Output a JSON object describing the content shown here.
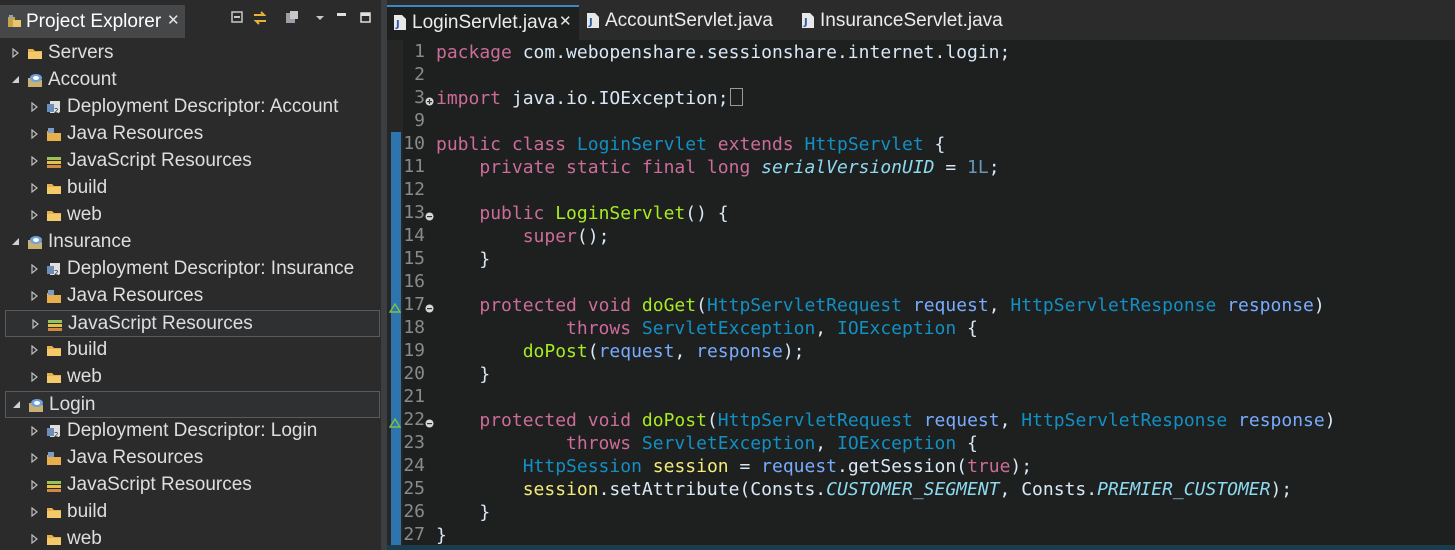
{
  "explorer": {
    "title": "Project Explorer",
    "close_glyph": "✕",
    "toolbar": [
      {
        "icon": "collapse-all-icon"
      },
      {
        "icon": "link-with-editor-icon"
      },
      {
        "icon": "filter-icon"
      },
      {
        "icon": "view-menu-icon"
      },
      {
        "icon": "minimize-icon"
      },
      {
        "icon": "maximize-icon"
      }
    ],
    "tree": [
      {
        "label": "Servers",
        "level": 1,
        "expanded": false,
        "icon": "folder-icon"
      },
      {
        "label": "Account",
        "level": 1,
        "expanded": true,
        "icon": "web-project-icon"
      },
      {
        "label": "Deployment Descriptor: Account",
        "level": 2,
        "expanded": false,
        "icon": "deployment-descriptor-icon"
      },
      {
        "label": "Java Resources",
        "level": 2,
        "expanded": false,
        "icon": "java-resources-icon"
      },
      {
        "label": "JavaScript Resources",
        "level": 2,
        "expanded": false,
        "icon": "javascript-resources-icon"
      },
      {
        "label": "build",
        "level": 2,
        "expanded": false,
        "icon": "folder-icon"
      },
      {
        "label": "web",
        "level": 2,
        "expanded": false,
        "icon": "folder-icon"
      },
      {
        "label": "Insurance",
        "level": 1,
        "expanded": true,
        "icon": "web-project-icon"
      },
      {
        "label": "Deployment Descriptor: Insurance",
        "level": 2,
        "expanded": false,
        "icon": "deployment-descriptor-icon"
      },
      {
        "label": "Java Resources",
        "level": 2,
        "expanded": false,
        "icon": "java-resources-icon"
      },
      {
        "label": "JavaScript Resources",
        "level": 2,
        "expanded": false,
        "icon": "javascript-resources-icon",
        "hover": true
      },
      {
        "label": "build",
        "level": 2,
        "expanded": false,
        "icon": "folder-icon"
      },
      {
        "label": "web",
        "level": 2,
        "expanded": false,
        "icon": "folder-icon"
      },
      {
        "label": "Login",
        "level": 1,
        "expanded": true,
        "icon": "web-project-icon",
        "selected": true
      },
      {
        "label": "Deployment Descriptor: Login",
        "level": 2,
        "expanded": false,
        "icon": "deployment-descriptor-icon"
      },
      {
        "label": "Java Resources",
        "level": 2,
        "expanded": false,
        "icon": "java-resources-icon"
      },
      {
        "label": "JavaScript Resources",
        "level": 2,
        "expanded": false,
        "icon": "javascript-resources-icon"
      },
      {
        "label": "build",
        "level": 2,
        "expanded": false,
        "icon": "folder-icon"
      },
      {
        "label": "web",
        "level": 2,
        "expanded": false,
        "icon": "folder-icon"
      }
    ]
  },
  "editor": {
    "tabs": [
      {
        "label": "LoginServlet.java",
        "active": true,
        "close": "✕"
      },
      {
        "label": "AccountServlet.java",
        "active": false
      },
      {
        "label": "InsuranceServlet.java",
        "active": false
      }
    ],
    "lines": [
      {
        "n": "1",
        "tokens": [
          [
            "kw",
            "package"
          ],
          [
            "plain",
            " com.webopenshare.sessionshare.internet.login;"
          ]
        ]
      },
      {
        "n": "2",
        "tokens": []
      },
      {
        "n": "3",
        "fold": "expand",
        "tokens": [
          [
            "kw",
            "import"
          ],
          [
            "plain",
            " java.io.IOException;"
          ],
          [
            "box",
            ""
          ]
        ]
      },
      {
        "n": "9",
        "tokens": []
      },
      {
        "n": "10",
        "tokens": [
          [
            "kw",
            "public class "
          ],
          [
            "cls",
            "LoginServlet"
          ],
          [
            "kw",
            " extends "
          ],
          [
            "cls",
            "HttpServlet"
          ],
          [
            "plain",
            " {"
          ]
        ]
      },
      {
        "n": "11",
        "tokens": [
          [
            "plain",
            "    "
          ],
          [
            "kw",
            "private static final long "
          ],
          [
            "field",
            "serialVersionUID"
          ],
          [
            "plain",
            " = "
          ],
          [
            "num",
            "1L"
          ],
          [
            "plain",
            ";"
          ]
        ]
      },
      {
        "n": "12",
        "tokens": []
      },
      {
        "n": "13",
        "fold": "collapse",
        "tokens": [
          [
            "plain",
            "    "
          ],
          [
            "kw",
            "public "
          ],
          [
            "meth",
            "LoginServlet"
          ],
          [
            "plain",
            "() {"
          ]
        ]
      },
      {
        "n": "14",
        "tokens": [
          [
            "plain",
            "        "
          ],
          [
            "kw",
            "super"
          ],
          [
            "plain",
            "();"
          ]
        ]
      },
      {
        "n": "15",
        "tokens": [
          [
            "plain",
            "    }"
          ]
        ]
      },
      {
        "n": "16",
        "tokens": []
      },
      {
        "n": "17",
        "fold": "collapse",
        "override": true,
        "tokens": [
          [
            "plain",
            "    "
          ],
          [
            "kw",
            "protected void "
          ],
          [
            "meth",
            "doGet"
          ],
          [
            "plain",
            "("
          ],
          [
            "cls",
            "HttpServletRequest"
          ],
          [
            "plain",
            " "
          ],
          [
            "param",
            "request"
          ],
          [
            "plain",
            ", "
          ],
          [
            "cls",
            "HttpServletResponse"
          ],
          [
            "plain",
            " "
          ],
          [
            "param",
            "response"
          ],
          [
            "plain",
            ")"
          ]
        ]
      },
      {
        "n": "18",
        "tokens": [
          [
            "plain",
            "            "
          ],
          [
            "kw",
            "throws "
          ],
          [
            "cls",
            "ServletException"
          ],
          [
            "plain",
            ", "
          ],
          [
            "cls",
            "IOException"
          ],
          [
            "plain",
            " {"
          ]
        ]
      },
      {
        "n": "19",
        "tokens": [
          [
            "plain",
            "        "
          ],
          [
            "meth",
            "doPost"
          ],
          [
            "plain",
            "("
          ],
          [
            "param",
            "request"
          ],
          [
            "plain",
            ", "
          ],
          [
            "param",
            "response"
          ],
          [
            "plain",
            ");"
          ]
        ]
      },
      {
        "n": "20",
        "tokens": [
          [
            "plain",
            "    }"
          ]
        ]
      },
      {
        "n": "21",
        "tokens": []
      },
      {
        "n": "22",
        "fold": "collapse",
        "override": true,
        "tokens": [
          [
            "plain",
            "    "
          ],
          [
            "kw",
            "protected void "
          ],
          [
            "meth",
            "doPost"
          ],
          [
            "plain",
            "("
          ],
          [
            "cls",
            "HttpServletRequest"
          ],
          [
            "plain",
            " "
          ],
          [
            "param",
            "request"
          ],
          [
            "plain",
            ", "
          ],
          [
            "cls",
            "HttpServletResponse"
          ],
          [
            "plain",
            " "
          ],
          [
            "param",
            "response"
          ],
          [
            "plain",
            ")"
          ]
        ]
      },
      {
        "n": "23",
        "tokens": [
          [
            "plain",
            "            "
          ],
          [
            "kw",
            "throws "
          ],
          [
            "cls",
            "ServletException"
          ],
          [
            "plain",
            ", "
          ],
          [
            "cls",
            "IOException"
          ],
          [
            "plain",
            " {"
          ]
        ]
      },
      {
        "n": "24",
        "tokens": [
          [
            "plain",
            "        "
          ],
          [
            "cls",
            "HttpSession"
          ],
          [
            "plain",
            " "
          ],
          [
            "local",
            "session"
          ],
          [
            "plain",
            " = "
          ],
          [
            "param",
            "request"
          ],
          [
            "plain",
            "."
          ],
          [
            "plain",
            "getSession("
          ],
          [
            "kw",
            "true"
          ],
          [
            "plain",
            ");"
          ]
        ]
      },
      {
        "n": "25",
        "tokens": [
          [
            "plain",
            "        "
          ],
          [
            "local",
            "session"
          ],
          [
            "plain",
            ".setAttribute(Consts."
          ],
          [
            "const",
            "CUSTOMER_SEGMENT"
          ],
          [
            "plain",
            ", Consts."
          ],
          [
            "const",
            "PREMIER_CUSTOMER"
          ],
          [
            "plain",
            ");"
          ]
        ]
      },
      {
        "n": "26",
        "tokens": [
          [
            "plain",
            "    }"
          ]
        ]
      },
      {
        "n": "27",
        "tokens": [
          [
            "plain",
            "}"
          ]
        ]
      }
    ]
  }
}
